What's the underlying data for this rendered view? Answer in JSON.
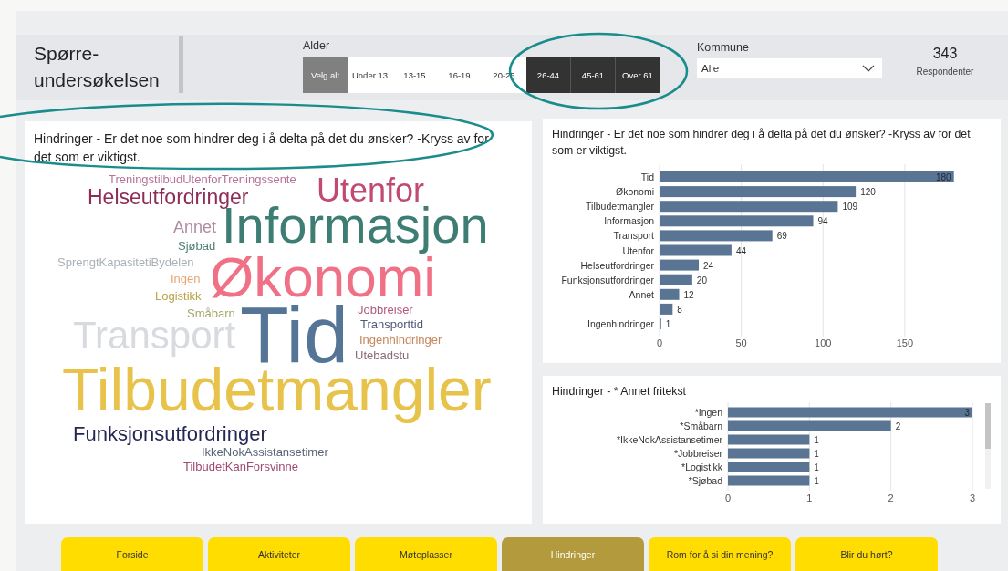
{
  "header": {
    "title": "Spørre-undersøkelsen",
    "age_filter": {
      "label": "Alder",
      "options": [
        {
          "label": "Velg alt",
          "kind": "select-all",
          "selected": false
        },
        {
          "label": "Under 13",
          "kind": "option",
          "selected": false
        },
        {
          "label": "13-15",
          "kind": "option",
          "selected": false
        },
        {
          "label": "16-19",
          "kind": "option",
          "selected": false
        },
        {
          "label": "20-25",
          "kind": "option",
          "selected": false
        },
        {
          "label": "26-44",
          "kind": "option",
          "selected": true
        },
        {
          "label": "45-61",
          "kind": "option",
          "selected": true
        },
        {
          "label": "Over 61",
          "kind": "option",
          "selected": true
        }
      ]
    },
    "municipality_filter": {
      "label": "Kommune",
      "value": "Alle"
    },
    "respondents": {
      "count": "343",
      "label": "Respondenter"
    }
  },
  "word_cloud": {
    "title": "Hindringer - Er det noe som hindrer deg i å delta på det du ønsker? -Kryss av for det som er viktigst.",
    "words": [
      {
        "text": "TreningstilbudUtenforTreningssente",
        "color": "#b5729a"
      },
      {
        "text": "Helseutfordringer",
        "color": "#8e2c56"
      },
      {
        "text": "Utenfor",
        "color": "#c04a73"
      },
      {
        "text": "Annet",
        "color": "#b08ca0"
      },
      {
        "text": "Sjøbad",
        "color": "#4d8075"
      },
      {
        "text": "Informasjon",
        "color": "#3d7d73"
      },
      {
        "text": "SprengtKapasitetiBydelen",
        "color": "#a9b1b6"
      },
      {
        "text": "Ingen",
        "color": "#e8a470"
      },
      {
        "text": "Økonomi",
        "color": "#f07185"
      },
      {
        "text": "Logistikk",
        "color": "#b9a44a"
      },
      {
        "text": "Småbarn",
        "color": "#a4a86a"
      },
      {
        "text": "Transport",
        "color": "#d7dbe0"
      },
      {
        "text": "Tid",
        "color": "#557596"
      },
      {
        "text": "Jobbreiser",
        "color": "#b05a80"
      },
      {
        "text": "Transporttid",
        "color": "#4f5a7a"
      },
      {
        "text": "Ingenhindringer",
        "color": "#c4865c"
      },
      {
        "text": "Utebadstu",
        "color": "#8a6a7a"
      },
      {
        "text": "Tilbudetmangler",
        "color": "#e8c34c"
      },
      {
        "text": "Funksjonsutfordringer",
        "color": "#262854"
      },
      {
        "text": "IkkeNokAssistansetimer",
        "color": "#5a6678"
      },
      {
        "text": "TilbudetKanForsvinne",
        "color": "#a04a72"
      }
    ]
  },
  "barriers_chart": {
    "chart_data": {
      "type": "bar",
      "orientation": "horizontal",
      "title": "Hindringer - Er det noe som hindrer deg i å delta på det du ønsker? -Kryss av for det som er viktigst.",
      "categories": [
        "Tid",
        "Økonomi",
        "Tilbudetmangler",
        "Informasjon",
        "Transport",
        "Utenfor",
        "Helseutfordringer",
        "Funksjonsutfordringer",
        "Annet",
        null,
        "Ingenhindringer"
      ],
      "series": [
        {
          "color": "#5a7494",
          "values": [
            180,
            120,
            109,
            94,
            69,
            44,
            24,
            20,
            12,
            8,
            1
          ]
        }
      ],
      "xlim": [
        0,
        180
      ],
      "xticks": [
        0,
        50,
        100,
        150
      ],
      "grid": true,
      "data_labels": true
    }
  },
  "other_chart": {
    "chart_data": {
      "type": "bar",
      "orientation": "horizontal",
      "title": "Hindringer - * Annet fritekst",
      "categories": [
        "*Ingen",
        "*Småbarn",
        "*IkkeNokAssistansetimer",
        "*Jobbreiser",
        "*Logistikk",
        "*Sjøbad"
      ],
      "series": [
        {
          "color": "#5a7494",
          "values": [
            3,
            2,
            1,
            1,
            1,
            1
          ]
        }
      ],
      "xlim": [
        0,
        3
      ],
      "xticks": [
        0,
        1,
        2,
        3
      ],
      "grid": true,
      "data_labels": true
    }
  },
  "navigation": [
    {
      "label": "Forside",
      "selected": false
    },
    {
      "label": "Aktiviteter",
      "selected": false
    },
    {
      "label": "Møteplasser",
      "selected": false
    },
    {
      "label": "Hindringer",
      "selected": true
    },
    {
      "label": "Rom for å si din mening?",
      "selected": false
    },
    {
      "label": "Blir du hørt?",
      "selected": false
    }
  ]
}
